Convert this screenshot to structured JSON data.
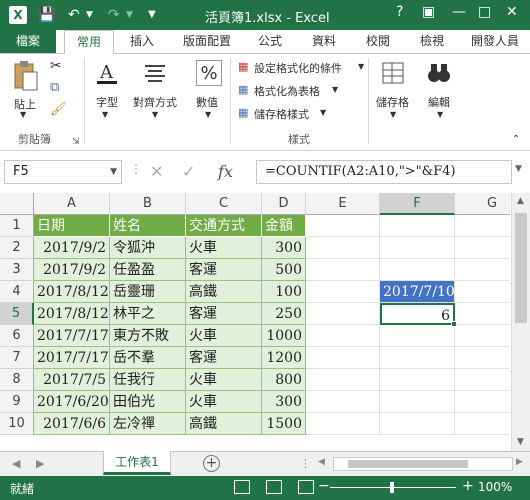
{
  "window": {
    "title": "活頁簿1.xlsx - Excel",
    "logo": "X",
    "help": "?",
    "minimize": "—",
    "restore": "□",
    "close": "✕"
  },
  "tabs": [
    "檔案",
    "常用",
    "插入",
    "版面配置",
    "公式",
    "資料",
    "校閱",
    "檢視",
    "開發人員"
  ],
  "active_tab": "常用",
  "ribbon": {
    "paste": "貼上",
    "clipboard_group": "剪貼簿",
    "font": "字型",
    "align": "對齊方式",
    "number": "數值",
    "cond_format": "設定格式化的條件",
    "format_table": "格式化為表格",
    "cell_styles": "儲存格樣式",
    "styles_group": "樣式",
    "cells": "儲存格",
    "editing": "編輯",
    "number_icon": "%"
  },
  "formula_bar": {
    "name_box": "F5",
    "fx": "fx",
    "formula": "=COUNTIF(A2:A10,\">\"&F4)"
  },
  "columns": [
    "A",
    "B",
    "C",
    "D",
    "E",
    "F",
    "G"
  ],
  "rows": [
    "1",
    "2",
    "3",
    "4",
    "5",
    "6",
    "7",
    "8",
    "9",
    "10"
  ],
  "table": {
    "headers": [
      "日期",
      "姓名",
      "交通方式",
      "金額"
    ],
    "rows": [
      [
        "2017/9/2",
        "令狐沖",
        "火車",
        "300"
      ],
      [
        "2017/9/2",
        "任盈盈",
        "客運",
        "500"
      ],
      [
        "2017/8/12",
        "岳靈珊",
        "高鐵",
        "100"
      ],
      [
        "2017/8/12",
        "林平之",
        "客運",
        "250"
      ],
      [
        "2017/7/17",
        "東方不敗",
        "火車",
        "1000"
      ],
      [
        "2017/7/17",
        "岳不羣",
        "客運",
        "1200"
      ],
      [
        "2017/7/5",
        "任我行",
        "火車",
        "800"
      ],
      [
        "2017/6/20",
        "田伯光",
        "火車",
        "300"
      ],
      [
        "2017/6/6",
        "左冷禪",
        "高鐵",
        "1500"
      ]
    ]
  },
  "f4_value": "2017/7/10",
  "f5_value": "6",
  "sheet_tab": "工作表1",
  "status": {
    "ready": "就緒",
    "zoom": "100%"
  }
}
